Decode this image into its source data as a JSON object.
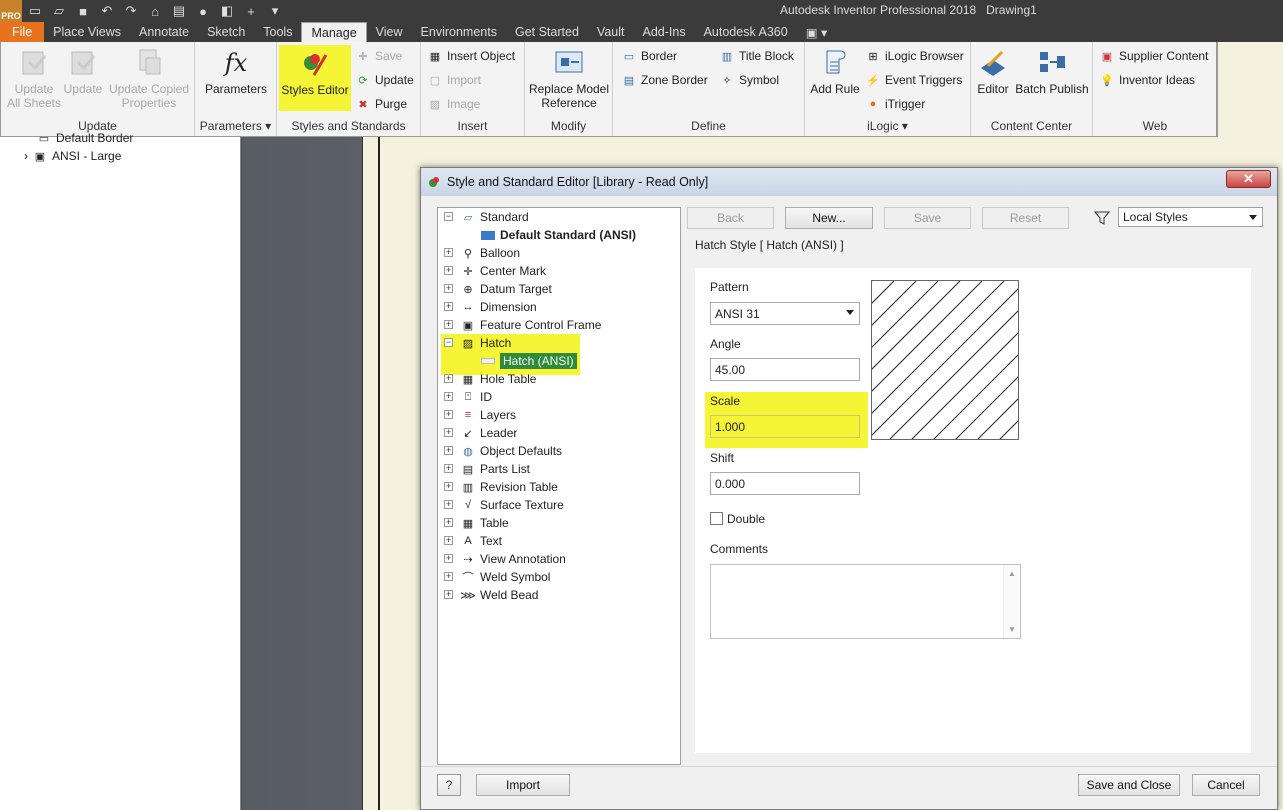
{
  "app": {
    "title": "Autodesk Inventor Professional 2018",
    "document": "Drawing1",
    "logo_text": "PRO"
  },
  "qat": [
    "new-icon",
    "open-icon",
    "save-icon",
    "undo-icon",
    "redo-icon",
    "home-icon",
    "print-icon",
    "color-icon",
    "measure-icon",
    "dropdown-icon"
  ],
  "menu": {
    "tabs": [
      "File",
      "Place Views",
      "Annotate",
      "Sketch",
      "Tools",
      "Manage",
      "View",
      "Environments",
      "Get Started",
      "Vault",
      "Add-Ins",
      "Autodesk A360"
    ],
    "active": "Manage"
  },
  "ribbon": {
    "update": {
      "label": "Update",
      "buttons": [
        {
          "line1": "Update",
          "line2": "All Sheets"
        },
        {
          "line1": "Update",
          "line2": ""
        },
        {
          "line1": "Update Copied",
          "line2": "Properties"
        }
      ]
    },
    "parameters": {
      "label": "Parameters",
      "button": "Parameters"
    },
    "styles": {
      "label": "Styles and Standards",
      "editor": "Styles Editor",
      "save": "Save",
      "update": "Update",
      "purge": "Purge"
    },
    "insert": {
      "label": "Insert",
      "insert_object": "Insert Object",
      "import": "Import",
      "image": "Image"
    },
    "modify": {
      "label": "Modify",
      "line1": "Replace Model",
      "line2": "Reference"
    },
    "define": {
      "label": "Define",
      "border": "Border",
      "zone_border": "Zone Border",
      "title_block": "Title Block",
      "symbol": "Symbol"
    },
    "ilogic": {
      "label": "iLogic",
      "add_rule": "Add Rule",
      "browser": "iLogic Browser",
      "event_triggers": "Event Triggers",
      "itrigger": "iTrigger"
    },
    "content_center": {
      "label": "Content Center",
      "editor": "Editor",
      "batch_publish": "Batch Publish"
    },
    "web": {
      "label": "Web",
      "supplier": "Supplier Content",
      "ideas": "Inventor Ideas"
    }
  },
  "browser": {
    "items": [
      "Default Border",
      "ANSI - Large"
    ]
  },
  "dialog": {
    "title": "Style and Standard Editor [Library - Read Only]",
    "buttons": {
      "back": "Back",
      "new": "New...",
      "save": "Save",
      "reset": "Reset"
    },
    "filter": "Local Styles",
    "heading": "Hatch Style [ Hatch (ANSI) ]",
    "tree": {
      "standard": "Standard",
      "default_standard": "Default Standard (ANSI)",
      "items": [
        "Balloon",
        "Center Mark",
        "Datum Target",
        "Dimension",
        "Feature Control Frame",
        "Hatch",
        "Hole Table",
        "ID",
        "Layers",
        "Leader",
        "Object Defaults",
        "Parts List",
        "Revision Table",
        "Surface Texture",
        "Table",
        "Text",
        "View Annotation",
        "Weld Symbol",
        "Weld Bead"
      ],
      "hatch_child": "Hatch (ANSI)"
    },
    "props": {
      "pattern_label": "Pattern",
      "pattern_value": "ANSI 31",
      "angle_label": "Angle",
      "angle_value": "45.00",
      "scale_label": "Scale",
      "scale_value": "1.000",
      "shift_label": "Shift",
      "shift_value": "0.000",
      "double_label": "Double",
      "double_checked": false,
      "comments_label": "Comments",
      "comments_value": ""
    },
    "footer": {
      "help": "?",
      "import": "Import",
      "save_close": "Save and Close",
      "cancel": "Cancel"
    }
  },
  "colors": {
    "highlight": "#f5f536",
    "selection": "#2e8b3a",
    "file_tab": "#e8731f"
  }
}
